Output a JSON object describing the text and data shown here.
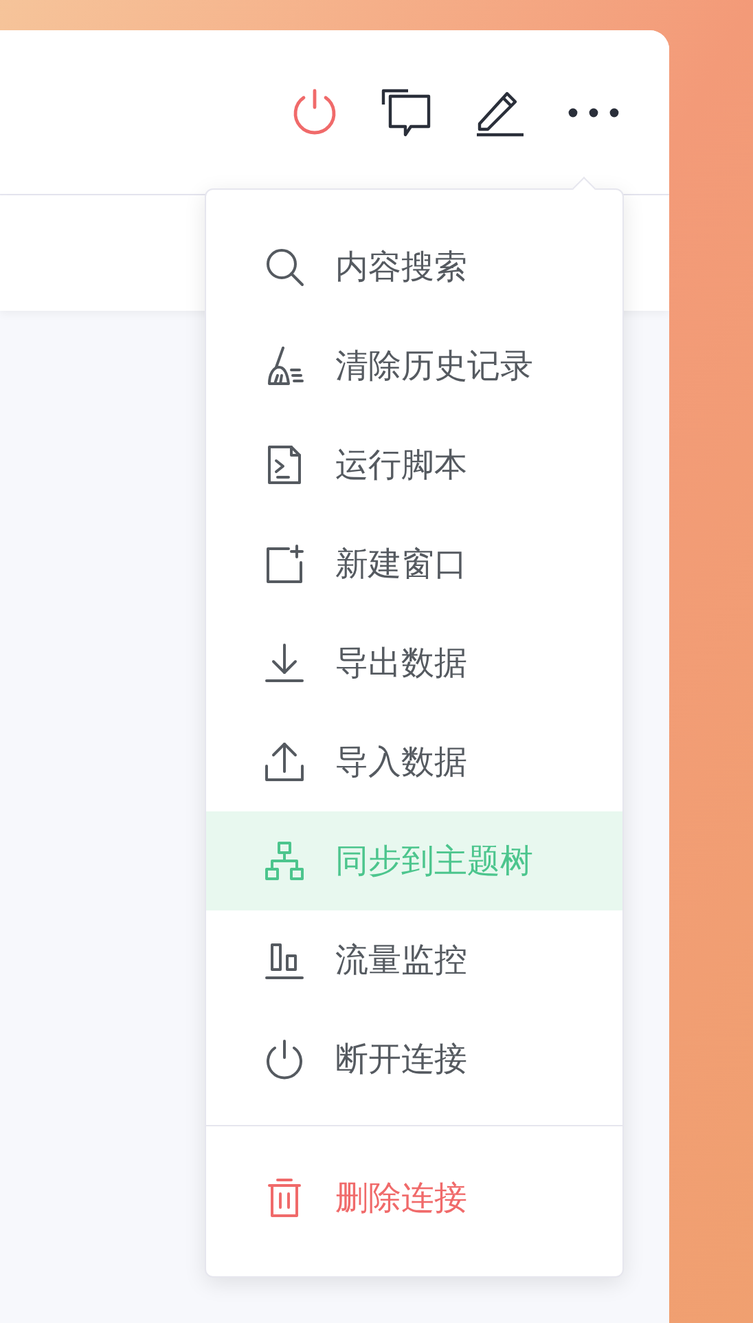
{
  "menu": {
    "items": [
      {
        "label": "内容搜索",
        "kind": "item",
        "selected": false
      },
      {
        "label": "清除历史记录",
        "kind": "item",
        "selected": false
      },
      {
        "label": "运行脚本",
        "kind": "item",
        "selected": false
      },
      {
        "label": "新建窗口",
        "kind": "item",
        "selected": false
      },
      {
        "label": "导出数据",
        "kind": "item",
        "selected": false
      },
      {
        "label": "导入数据",
        "kind": "item",
        "selected": false
      },
      {
        "label": "同步到主题树",
        "kind": "item",
        "selected": true
      },
      {
        "label": "流量监控",
        "kind": "item",
        "selected": false
      },
      {
        "label": "断开连接",
        "kind": "item",
        "selected": false
      },
      {
        "label": "删除连接",
        "kind": "danger",
        "selected": false
      }
    ]
  }
}
